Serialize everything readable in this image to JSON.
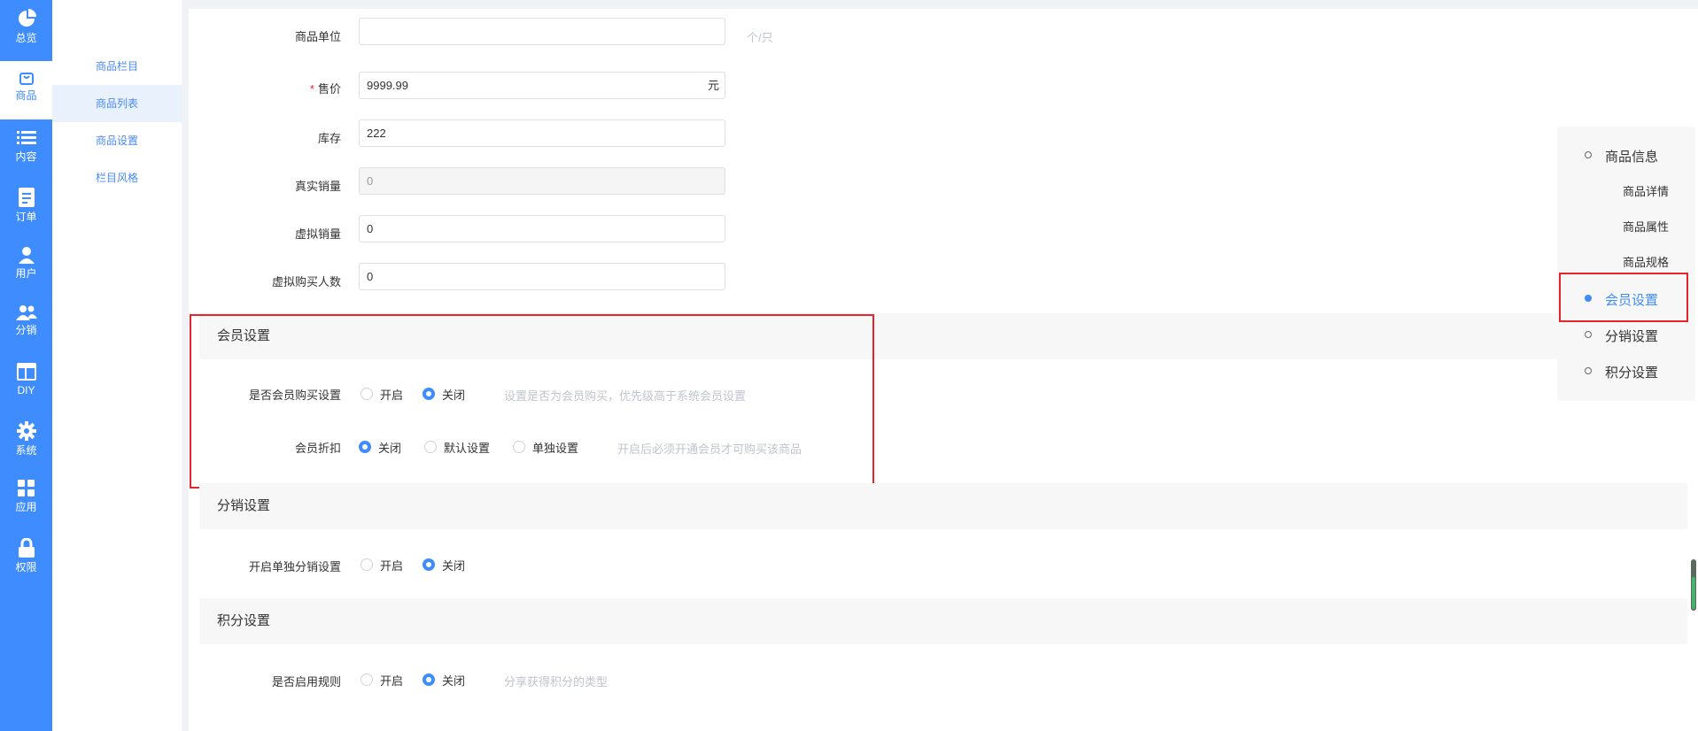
{
  "nav_rail": [
    {
      "label": "总览",
      "icon": "pie-chart-icon",
      "active": false
    },
    {
      "label": "商品",
      "icon": "shopping-bag-icon",
      "active": true
    },
    {
      "label": "内容",
      "icon": "list-icon",
      "active": false
    },
    {
      "label": "订单",
      "icon": "document-icon",
      "active": false
    },
    {
      "label": "用户",
      "icon": "user-icon",
      "active": false
    },
    {
      "label": "分销",
      "icon": "users-icon",
      "active": false
    },
    {
      "label": "DIY",
      "icon": "layout-icon",
      "active": false
    },
    {
      "label": "系统",
      "icon": "gear-icon",
      "active": false
    },
    {
      "label": "应用",
      "icon": "grid-icon",
      "active": false
    },
    {
      "label": "权限",
      "icon": "lock-icon",
      "active": false
    }
  ],
  "sub_menu": [
    {
      "label": "商品栏目",
      "active": false
    },
    {
      "label": "商品列表",
      "active": true
    },
    {
      "label": "商品设置",
      "active": false
    },
    {
      "label": "栏目风格",
      "active": false
    }
  ],
  "form": {
    "unit": {
      "label": "商品单位",
      "value": "",
      "hint": "个/只"
    },
    "price": {
      "label": "售价",
      "required": "*",
      "value": "9999.99",
      "suffix": "元"
    },
    "stock": {
      "label": "库存",
      "value": "222"
    },
    "real_sales": {
      "label": "真实销量",
      "value": "0"
    },
    "virtual_sales": {
      "label": "虚拟销量",
      "value": "0"
    },
    "virtual_buyers": {
      "label": "虚拟购买人数",
      "value": "0"
    }
  },
  "member_section": {
    "title": "会员设置",
    "buy": {
      "label": "是否会员购买设置",
      "options": [
        "开启",
        "关闭"
      ],
      "selected": 1,
      "hint": "设置是否为会员购买，优先级高于系统会员设置"
    },
    "discount": {
      "label": "会员折扣",
      "options": [
        "关闭",
        "默认设置",
        "单独设置"
      ],
      "selected": 0,
      "hint": "开启后必须开通会员才可购买该商品"
    }
  },
  "distribution_section": {
    "title": "分销设置",
    "setting": {
      "label": "开启单独分销设置",
      "options": [
        "开启",
        "关闭"
      ],
      "selected": 1
    }
  },
  "points_section": {
    "title": "积分设置",
    "setting": {
      "label": "是否启用规则",
      "options": [
        "开启",
        "关闭"
      ],
      "selected": 1,
      "hint": "分享获得积分的类型"
    }
  },
  "anchor_nav": [
    {
      "label": "商品信息",
      "level": 1,
      "active": false
    },
    {
      "label": "商品详情",
      "level": 2,
      "active": false
    },
    {
      "label": "商品属性",
      "level": 2,
      "active": false
    },
    {
      "label": "商品规格",
      "level": 2,
      "active": false
    },
    {
      "label": "会员设置",
      "level": 1,
      "active": true
    },
    {
      "label": "分销设置",
      "level": 1,
      "active": false
    },
    {
      "label": "积分设置",
      "level": 1,
      "active": false
    }
  ],
  "colors": {
    "primary": "#3f8cff",
    "highlight": "#e5242b",
    "section_bg": "#f7f7f7"
  }
}
